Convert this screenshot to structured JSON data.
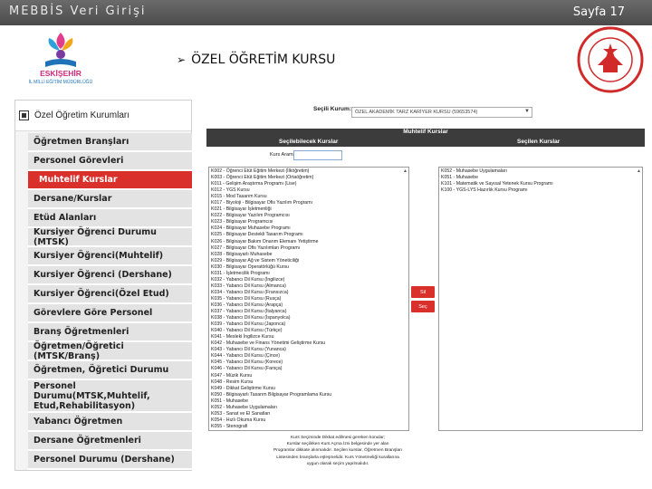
{
  "header": {
    "title": "MEBBİS Veri Girişi",
    "page": "Sayfa 17"
  },
  "logo_left": {
    "text": "ESKİŞEHİR",
    "sub": "İL MİLLİ EĞİTİM MÜDÜRLÜĞÜ"
  },
  "heading": "ÖZEL ÖĞRETİM KURSU",
  "nav": {
    "title": "Özel Öğretim Kurumları",
    "items": [
      {
        "label": "Öğretmen Branşları"
      },
      {
        "label": "Personel Görevleri"
      },
      {
        "label": "Muhtelif Kurslar",
        "active": true
      },
      {
        "label": "Dersane/Kurslar"
      },
      {
        "label": "Etüd Alanları"
      },
      {
        "label": "Kursiyer Öğrenci Durumu (MTSK)"
      },
      {
        "label": "Kursiyer Öğrenci(Muhtelif)"
      },
      {
        "label": "Kursiyer Öğrenci (Dershane)"
      },
      {
        "label": "Kursiyer Öğrenci(Özel Etud)"
      },
      {
        "label": "Görevlere Göre Personel"
      },
      {
        "label": "Branş Öğretmenleri"
      },
      {
        "label": "Öğretmen/Öğretici (MTSK/Branş)"
      },
      {
        "label": "Öğretmen, Öğretici Durumu"
      },
      {
        "label": "Personel Durumu(MTSK,Muhtelif,\nEtud,Rehabilitasyon)",
        "tall": true
      },
      {
        "label": "Yabancı Öğretmen"
      },
      {
        "label": "Dersane Öğretmenleri"
      },
      {
        "label": "Personel Durumu (Dershane)"
      }
    ]
  },
  "form": {
    "select_label": "Seçili Kurum:",
    "select_value": "ÖZEL AKADEMİK TARZ KARİYER KURSU (59653574)",
    "section_title": "Muhtelif Kurslar",
    "left_header": "Seçilebilecek Kurslar",
    "right_header": "Seçilen Kurslar",
    "search_label": "Kurs Arama",
    "search_value": "",
    "btn_remove": "Sil",
    "btn_add": "Seç",
    "available": [
      "K002 - Öğrenci Etüt Eğitim Merkezi (İlköğretim)",
      "K003 - Öğrenci Etüt Eğitim Merkezi (Ortaöğretim)",
      "K011 - Gelişim Araştırma Programı (Lise)",
      "K012 - YGS Kursu",
      "K015 - Mod Tasarım Kursu",
      "K017 - Biyoloji - Bilgisayar Ofis Yazılım Programı",
      "K021 - Bilgisayar İşletmenliği",
      "K022 - Bilgisayar Yazılım Programcısı",
      "K023 - Bilgisayar Programcısı",
      "K024 - Bilgisayar Muhasebe Programı",
      "K025 - Bilgisayar Destekli Tasarım Programı",
      "K026 - Bilgisayar Bakım Onarım Elemanı Yetiştirme",
      "K027 - Bilgisayar Ofis Yazılımları Programı",
      "K028 - Bilgisayarlı Muhasebe",
      "K029 - Bilgisayar Ağ ve Sistem Yöneticiliği",
      "K030 - Bilgisayar Operatörlüğü Kursu",
      "K031 - İşletmecilik Programı",
      "K032 - Yabancı Dil Kursu (İngilizce)",
      "K033 - Yabancı Dil Kursu (Almanca)",
      "K034 - Yabancı Dil Kursu (Fransızca)",
      "K035 - Yabancı Dil Kursu (Rusça)",
      "K036 - Yabancı Dil Kursu (Arapça)",
      "K037 - Yabancı Dil Kursu (İtalyanca)",
      "K038 - Yabancı Dil Kursu (İspanyolca)",
      "K039 - Yabancı Dil Kursu (Japonca)",
      "K040 - Yabancı Dil Kursu (Türkçe)",
      "K041 - Mesleki İngilizce Kursu",
      "K042 - Muhasebe ve Finans Yönetimi Geliştirme Kursu",
      "K043 - Yabancı Dil Kursu (Yunanca)",
      "K044 - Yabancı Dil Kursu (Çince)",
      "K045 - Yabancı Dil Kursu (Korece)",
      "K046 - Yabancı Dil Kursu (Farsça)",
      "K047 - Müzik Kursu",
      "K048 - Resim Kursu",
      "K049 - Dikkat Geliştirme Kursu",
      "K050 - Bilgisayarlı Tasarım Bilgisayar Programlama Kursu",
      "K051 - Muhasebe",
      "K052 - Muhasebe Uygulamaları",
      "K053 - Sanat ve El Sanatları",
      "K054 - Hızlı Okuma Kursu",
      "K055 - Stenografi",
      "K060 - Hemşire Yardımcılığı",
      "K061 - Elektrik",
      "K062 - Elektronik",
      "K063 - Bilgisayar Teknisyenliği",
      "K064 - Satranç Kursu",
      "K070 - İş Sağlığı ve Güvenliği Kursu",
      "K071 - Dans Kursu",
      "K072 - Bale Kursu (Akademik Grubu)"
    ],
    "selected": [
      "K052 - Muhasebe Uygulamaları",
      "K051 - Muhasebe",
      "K101 - Matematik ve Sayısal Yetenek Kursu Programı",
      "K100 - YGS-LYS Hazırlık Kursu Programı"
    ],
    "notes": [
      "Kurs Seçiminde Dikkat edilmesi gereken konular;",
      "Kurslar seçilirken Kurs Açma İzni belgesinde yer alan",
      "Programlar dikkate alınmalıdır. Seçilen kurslar, Öğretmen Branşları",
      "Listesinden branşlarla eşleşmelidir. Kurs Yönetmeliği kurallarına",
      "uygun olarak seçim yapılmalıdır."
    ]
  }
}
